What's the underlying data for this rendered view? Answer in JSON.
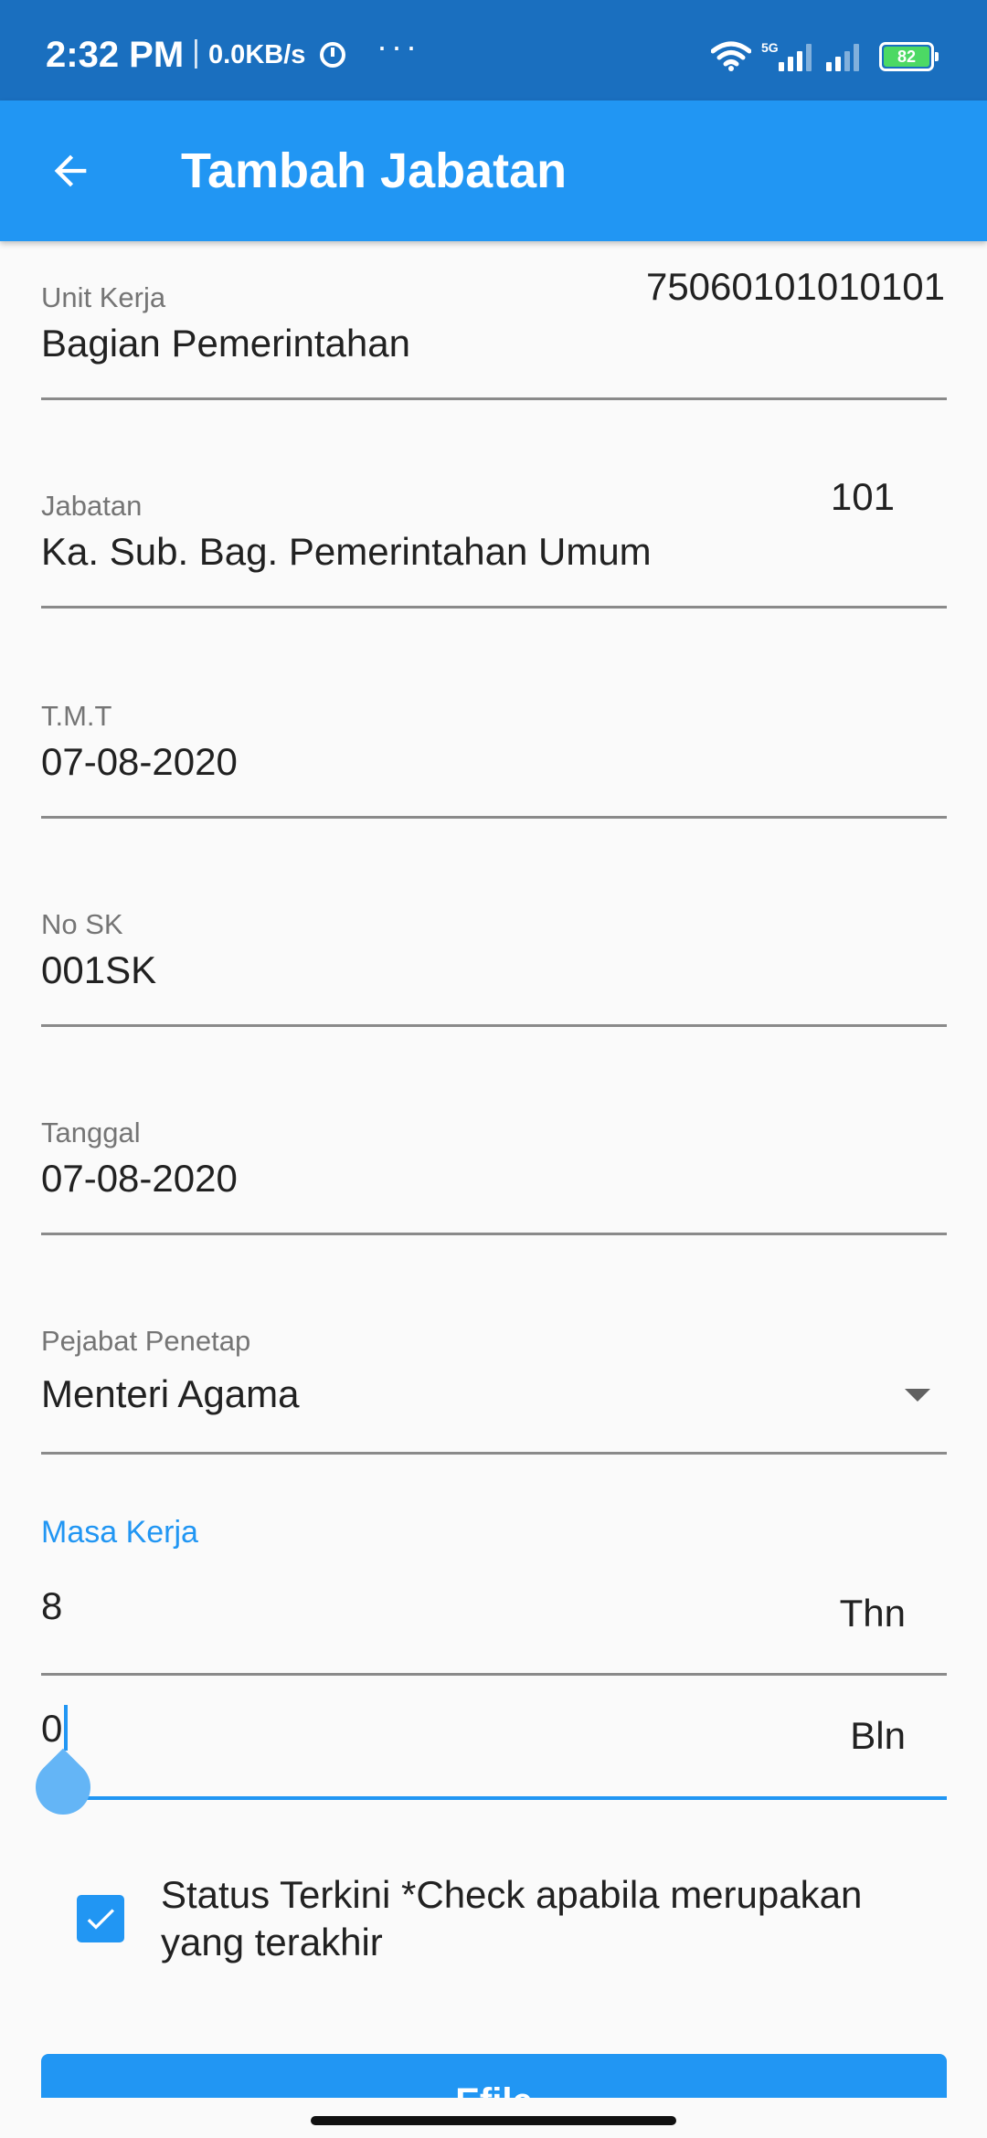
{
  "status_bar": {
    "time": "2:32 PM",
    "separator": "|",
    "speed": "0.0KB/s",
    "more": "···",
    "network": "5G",
    "battery": "82",
    "icons": [
      "alarm-icon",
      "wifi-icon",
      "signal-icon",
      "battery-icon"
    ]
  },
  "app_bar": {
    "title": "Tambah Jabatan",
    "back_icon": "arrow-left-icon",
    "background": "#2196f3"
  },
  "form": {
    "unit_kerja": {
      "label": "Unit Kerja",
      "value": "Bagian Pemerintahan",
      "code": "75060101010101"
    },
    "jabatan": {
      "label": "Jabatan",
      "value": "Ka. Sub. Bag. Pemerintahan Umum",
      "code": "101"
    },
    "tmt": {
      "label": "T.M.T",
      "value": "07-08-2020"
    },
    "no_sk": {
      "label": "No SK",
      "value": "001SK"
    },
    "tanggal": {
      "label": "Tanggal",
      "value": "07-08-2020"
    },
    "pejabat_penetap": {
      "label": "Pejabat Penetap",
      "value": "Menteri Agama"
    },
    "masa_kerja": {
      "label": "Masa Kerja",
      "tahun": {
        "value": "8",
        "suffix": "Thn"
      },
      "bulan": {
        "value": "0",
        "suffix": "Bln"
      }
    },
    "status_terkini": {
      "checked": true,
      "label": "Status Terkini *Check apabila merupakan yang terakhir"
    },
    "efile_button": "Efile"
  },
  "colors": {
    "primary": "#2196f3",
    "status_bar": "#1a6fbf"
  }
}
